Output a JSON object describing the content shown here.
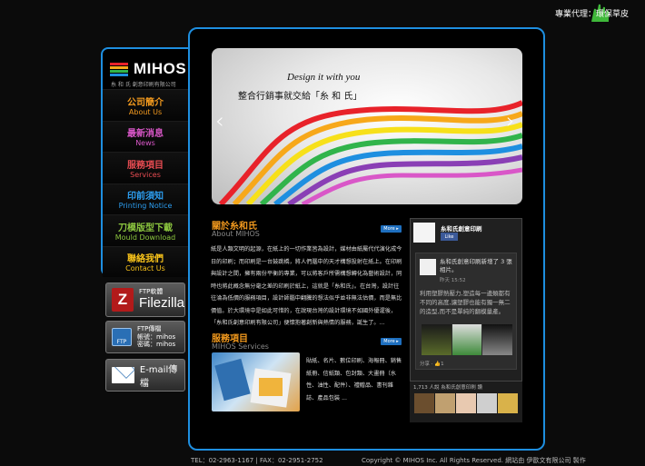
{
  "agent_note": "專業代理：環保草皮",
  "logo": {
    "name": "MIHOS",
    "sub": "糸 和 氏  創意印刷有限公司",
    "bar_colors": [
      "#e8222a",
      "#f7a81a",
      "#31b44b",
      "#1e8fe0"
    ]
  },
  "menu": [
    {
      "zh": "公司簡介",
      "en": "About Us",
      "color": "#f39a1e"
    },
    {
      "zh": "最新消息",
      "en": "News",
      "color": "#d957c8"
    },
    {
      "zh": "服務項目",
      "en": "Services",
      "color": "#e84c52"
    },
    {
      "zh": "印前須知",
      "en": "Printing Notice",
      "color": "#2d9ef0"
    },
    {
      "zh": "刀模版型下載",
      "en": "Mould Download",
      "color": "#8cc63f"
    },
    {
      "zh": "聯絡我們",
      "en": "Contact Us",
      "color": "#f7c21a"
    }
  ],
  "filezilla": {
    "icon": "filezilla-icon",
    "small": "FTP軟體",
    "big": "Filezilla"
  },
  "ftp": {
    "icon": "ftp-icon",
    "title": "FTP傳檔",
    "account": "帳號：mihos",
    "password": "密碼：mihos"
  },
  "email": {
    "icon": "envelope-icon",
    "label": "E-mail傳檔"
  },
  "banner": {
    "en": "Design it with you",
    "zh": "整合行銷事就交給「糸 和 氏」",
    "prev": "‹",
    "next": "›"
  },
  "about": {
    "title": "關於糸和氏",
    "sub": "About MIHOS",
    "more": "More ▸",
    "text": "紙是人類文明的起源，在紙上的一切作業皆為設計，媒材由紙屬代代演化成今日的印刷；而印刷是一台鼓跳橋，將人們腦中的天才構想投射在紙上。在印刷與設計之間，擁有兩份平衡的專業，可以將客戶所需構想轉化為藝術設計，同時也將此概念無分毫之差的印刷於紙上，這就是「糸和氏」。在台灣，設計往往淪為低價的服務項目，設計師腦中翻騰的想法似乎並非無法估價，而是無比價值。於大環境中是如此可惜的，在說現台灣的設計環境不如國外優渥後，「糸和氏創意印刷有限公司」便懷抱著創新與熱情的服務，誕生了。..."
  },
  "services": {
    "title": "服務項目",
    "sub": "MIHOS Services",
    "more": "More ▸",
    "text": "貼紙、名片、數位印刷、海報冊、銷售紙冊、信紙類、包封類、大畫冊（水性、油性、配件）、禮贈品、書刊雜誌、產品包裝 ..."
  },
  "facebook": {
    "page_name": "糸和氏創意印刷",
    "like": "Like",
    "post_title": "糸和氏創意印刷新增了 3 張相片。",
    "post_time": "昨天 15:52",
    "post_text": "利用塑膠熱壓力,塑造每一邊類都有不同的高度,讓塑膠也能有獨一無二的造型,而不是單純的翻模量產。",
    "share": "分享 · 👍1",
    "fans": "1,713 人說 糸和氏創意印刷 讚"
  },
  "footer": {
    "contact": "TEL：02-2963-1167 | FAX：02-2951-2752",
    "copyright": "Copyright © MIHOS Inc. All Rights Reserved. 網站由 伊歐文有限公司 製作"
  }
}
